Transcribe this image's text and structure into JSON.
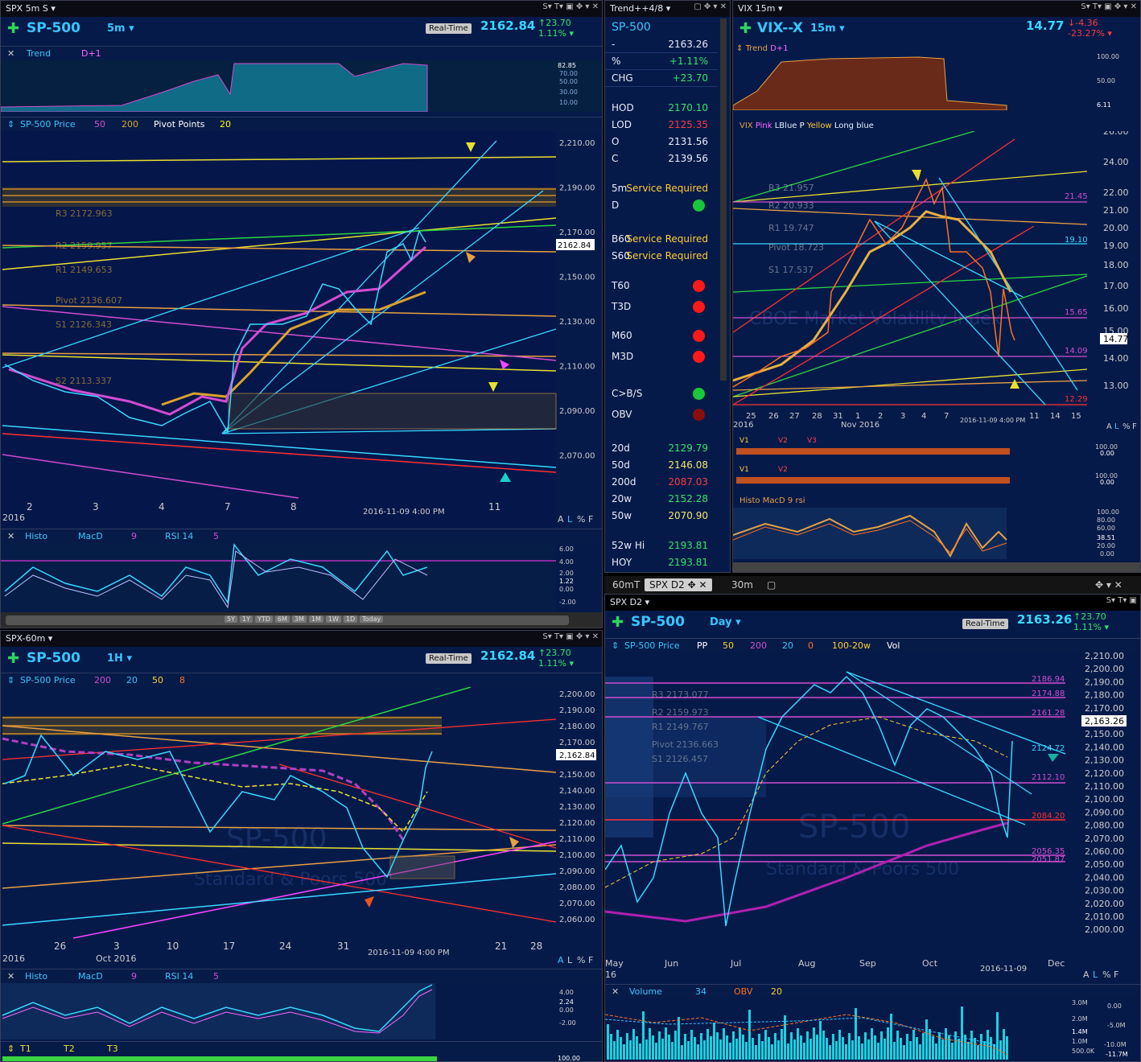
{
  "p1": {
    "title": "SPX 5m S",
    "symbol": "SP-500",
    "interval": "5m",
    "realtime": "Real-Time",
    "last": "2162.84",
    "chg": "23.70",
    "pct": "1.11%",
    "trend": "Trend",
    "trend_d": "D+1",
    "price_lbl": "SP-500 Price",
    "ma1": "50",
    "ma2": "200",
    "pivot_lbl": "Pivot Points",
    "pivot_n": "20",
    "osc": [
      "Histo",
      "MacD",
      "9",
      "RSI 14",
      "5"
    ],
    "trend_axis": [
      "82.85",
      "70.00",
      "50.00",
      "30.00",
      "10.00"
    ],
    "osc_axis": [
      "6.00",
      "4.00",
      "2.00",
      "1.22",
      "0.00",
      "-2.00"
    ],
    "pivot_labels": [
      "R3 2172.963",
      "R2 2159.957",
      "R1 2149.653",
      "Pivot 2136.607",
      "S1 2126.343",
      "S2 2113.337"
    ],
    "timeframes": [
      "5Y",
      "1Y",
      "YTD",
      "6M",
      "3M",
      "1M",
      "1W",
      "1D",
      "Today"
    ],
    "stamp": "2016-11-09 4:00 PM",
    "year": "2016",
    "alf": [
      "A",
      "L",
      "%",
      "F"
    ]
  },
  "p2": {
    "title": "Trend++4/8",
    "symbol": "SP-500",
    "rows": [
      {
        "k": "-",
        "v": "2163.26",
        "c": "#e8ecf6"
      },
      {
        "k": "%",
        "v": "+1.11%",
        "c": "#35e36a"
      },
      {
        "k": "CHG",
        "v": "+23.70",
        "c": "#35e36a"
      },
      {
        "k": "HOD",
        "v": "2170.10",
        "c": "#35e36a"
      },
      {
        "k": "LOD",
        "v": "2125.35",
        "c": "#ff3b3b"
      },
      {
        "k": "O",
        "v": "2131.56",
        "c": "#e8ecf6"
      },
      {
        "k": "C",
        "v": "2139.56",
        "c": "#e8ecf6"
      },
      {
        "k": "5m",
        "v": "Service Required",
        "c": "#ffcc33"
      },
      {
        "k": "D",
        "dot": "#19c83a"
      },
      {
        "k": "B60",
        "v": "Service Required",
        "c": "#ffcc33"
      },
      {
        "k": "S60",
        "v": "Service Required",
        "c": "#ffcc33"
      },
      {
        "k": "T60",
        "dot": "#ff1a1a"
      },
      {
        "k": "T3D",
        "dot": "#ff1a1a"
      },
      {
        "k": "M60",
        "dot": "#ff1a1a"
      },
      {
        "k": "M3D",
        "dot": "#ff1a1a"
      },
      {
        "k": "C>B/S",
        "dot": "#19c83a"
      },
      {
        "k": "OBV",
        "dot": "#8a0e0e"
      },
      {
        "k": "20d",
        "v": "2129.79",
        "c": "#35e36a"
      },
      {
        "k": "50d",
        "v": "2146.08",
        "c": "#f3e56b"
      },
      {
        "k": "200d",
        "v": "2087.03",
        "c": "#ff3b3b"
      },
      {
        "k": "20w",
        "v": "2152.28",
        "c": "#35e36a"
      },
      {
        "k": "50w",
        "v": "2070.90",
        "c": "#f3e56b"
      },
      {
        "k": "52w Hi",
        "v": "2193.81",
        "c": "#35e36a"
      },
      {
        "k": "HOY",
        "v": "2193.81",
        "c": "#35e36a"
      }
    ]
  },
  "p3": {
    "title": "VIX 15m",
    "symbol": "VIX--X",
    "interval": "15m",
    "last": "14.77",
    "chg": "-4.36",
    "pct": "-23.27%",
    "trend": "Trend",
    "trend_d": "D+1",
    "legend": [
      "VIX",
      "Pink",
      "LBlue",
      "P",
      "Yellow",
      "Long blue"
    ],
    "axis": [
      "26.00",
      "24.00",
      "22.00",
      "21.00",
      "20.00",
      "19.00",
      "18.00",
      "17.00",
      "16.00",
      "15.00",
      "14.77",
      "14.00",
      "13.00"
    ],
    "levels": [
      "21.45",
      "19.10",
      "15.65",
      "14.09",
      "12.29"
    ],
    "pivots": [
      "R3 21.957",
      "R2 20.933",
      "R1 19.747",
      "Pivot 18.723",
      "S1 17.537"
    ],
    "dates": [
      "25",
      "26",
      "27",
      "28",
      "31",
      "1",
      "2",
      "3",
      "4",
      "7",
      "11",
      "14",
      "15"
    ],
    "month": "Nov 2016",
    "year": "2016",
    "stamp": "2016-11-09 4:00 PM",
    "trend_axis": [
      "100.00",
      "50.00",
      "6.11"
    ],
    "v_row1": [
      "V1",
      "V2",
      "V3"
    ],
    "v_row2": [
      "V1",
      "V2"
    ],
    "v_axis": [
      "100.00",
      "0.00"
    ],
    "osc": [
      "Histo",
      "MacD",
      "9",
      "rsi"
    ],
    "osc_axis": [
      "100.00",
      "80.00",
      "60.00",
      "38.51",
      "20.00",
      "0.00"
    ],
    "watermark": "CBOE Market Volatility Index",
    "alf": [
      "A",
      "L",
      "%",
      "F"
    ]
  },
  "p4": {
    "title": "SPX-60m",
    "symbol": "SP-500",
    "interval": "1H",
    "realtime": "Real-Time",
    "last": "2162.84",
    "chg": "23.70",
    "pct": "1.11%",
    "price_lbl": "SP-500 Price",
    "ma": [
      "200",
      "20",
      "50",
      "8"
    ],
    "axis": [
      "2,200.00",
      "2,190.00",
      "2,180.00",
      "2,170.00",
      "2,162.84",
      "2,150.00",
      "2,140.00",
      "2,130.00",
      "2,120.00",
      "2,110.00",
      "2,100.00",
      "2,090.00",
      "2,080.00",
      "2,070.00",
      "2,060.00"
    ],
    "dates": [
      "26",
      "3",
      "10",
      "17",
      "24",
      "31",
      "21",
      "28"
    ],
    "month": "Oct 2016",
    "year": "2016",
    "stamp": "2016-11-09 4:00 PM",
    "osc": [
      "Histo",
      "MacD",
      "9",
      "RSI 14",
      "5"
    ],
    "osc_axis": [
      "4.00",
      "2.24",
      "0.00",
      "-2.00"
    ],
    "t": [
      "T1",
      "T2",
      "T3"
    ],
    "t_axis": "100.00",
    "watermark": "SP-500",
    "watermark2": "Standard & Poors 500",
    "alf": [
      "A",
      "L",
      "%",
      "F"
    ]
  },
  "p5": {
    "tabs": [
      "60mT",
      "SPX D2",
      "30m"
    ],
    "title": "SPX D2",
    "symbol": "SP-500",
    "interval": "Day",
    "realtime": "Real-Time",
    "last": "2163.26",
    "chg": "23.70",
    "pct": "1.11%",
    "price_lbl": "SP-500 Price",
    "params": [
      "PP",
      "50",
      "200",
      "20",
      "0",
      "100-20w",
      "Vol"
    ],
    "axis": [
      "2,210.00",
      "2,200.00",
      "2,190.00",
      "2,180.00",
      "2,170.00",
      "2,163.26",
      "2,150.00",
      "2,140.00",
      "2,130.00",
      "2,120.00",
      "2,110.00",
      "2,100.00",
      "2,090.00",
      "2,080.00",
      "2,070.00",
      "2,060.00",
      "2,050.00",
      "2,040.00",
      "2,030.00",
      "2,020.00",
      "2,010.00",
      "2,000.00"
    ],
    "levels": [
      "2186.94",
      "2174.88",
      "2161.28",
      "2124.72",
      "2112.10",
      "2084.20",
      "2056.35",
      "2051.87"
    ],
    "pivots": [
      "R3 2173.077",
      "R2 2159.973",
      "R1 2149.767",
      "Pivot 2136.663",
      "S1 2126.457"
    ],
    "months": [
      "Jun",
      "Jul",
      "Aug",
      "Sep",
      "Oct",
      "Dec"
    ],
    "month_start": "May",
    "year": "16",
    "stamp": "2016-11-09",
    "vol": [
      "Volume",
      "34",
      "OBV",
      "20"
    ],
    "vol_axis": [
      "3.0M",
      "2.0M",
      "1.4M",
      "1.0M",
      "500.0K"
    ],
    "obv_axis": [
      "0.00",
      "-5.0M",
      "-10.0M",
      "-11.7M"
    ],
    "watermark": "SP-500",
    "watermark2": "Standard & Poors 500",
    "alf": [
      "A",
      "L",
      "%",
      "F"
    ]
  },
  "chart_data": [
    {
      "type": "line",
      "title": "SPX 5m S",
      "x": [
        "2",
        "3",
        "4",
        "7",
        "8",
        "11"
      ],
      "series": [
        {
          "name": "SP-500 Price",
          "values": [
            2110,
            2098,
            2088,
            2098,
            2135,
            2162.84
          ]
        }
      ],
      "ylim": [
        2060,
        2215
      ],
      "y_ticks": [
        2070,
        2090,
        2110,
        2130,
        2150,
        2170,
        2190,
        2210
      ]
    },
    {
      "type": "line",
      "title": "VIX 15m",
      "x": [
        "25",
        "26",
        "27",
        "28",
        "31",
        "1",
        "2",
        "3",
        "4",
        "7",
        "11",
        "14",
        "15"
      ],
      "series": [
        {
          "name": "VIX",
          "values": [
            13.3,
            13.6,
            14.1,
            14.8,
            17.8,
            20.0,
            19.0,
            20.3,
            22.0,
            18.5,
            14.77
          ]
        }
      ],
      "ylim": [
        12.0,
        26.5
      ]
    },
    {
      "type": "line",
      "title": "SPX-60m",
      "x": [
        "26",
        "3",
        "10",
        "17",
        "24",
        "31",
        "21",
        "28"
      ],
      "series": [
        {
          "name": "SP-500 Price",
          "values": [
            2160,
            2152,
            2145,
            2130,
            2140,
            2110,
            2162.84
          ]
        }
      ],
      "ylim": [
        2055,
        2205
      ]
    },
    {
      "type": "line",
      "title": "SPX D2",
      "x": [
        "Jun",
        "Jul",
        "Aug",
        "Sep",
        "Oct",
        "Dec"
      ],
      "series": [
        {
          "name": "SP-500 Price",
          "values": [
            2090,
            2100,
            2170,
            2180,
            2130,
            2140,
            2163.26
          ]
        }
      ],
      "ylim": [
        1995,
        2215
      ]
    }
  ]
}
